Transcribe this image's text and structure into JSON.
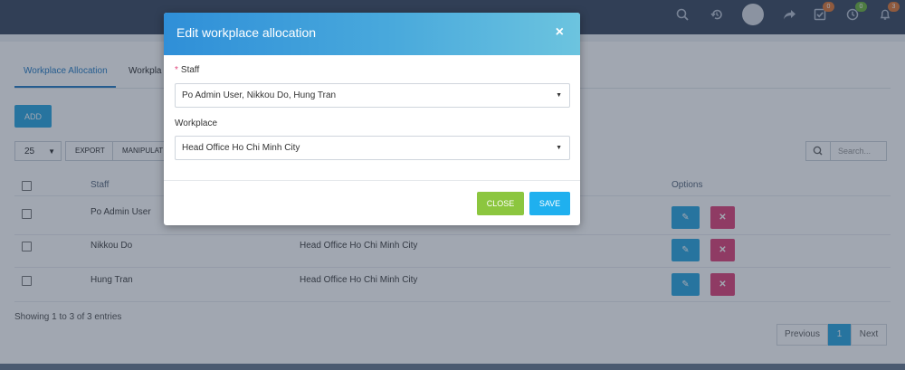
{
  "topbar": {
    "icons": [
      "search-icon",
      "history-icon",
      "share-icon",
      "tasks-icon",
      "clock-icon",
      "bell-icon"
    ],
    "badges": {
      "tasks": "0",
      "clock": "0",
      "bell": "3"
    },
    "badge_colors": {
      "tasks": "#e07b39",
      "clock": "#6fb43f",
      "bell": "#e07b39"
    }
  },
  "tabs": {
    "workplace_allocation": "Workplace Allocation",
    "second_tab": "Workpla"
  },
  "toolbar": {
    "add_label": "ADD",
    "page_size": "25",
    "export_label": "EXPORT",
    "manipulate_label": "MANIPULAT",
    "search_placeholder": "Search..."
  },
  "table": {
    "headers": {
      "staff": "Staff",
      "options": "Options"
    },
    "rows": [
      {
        "staff": "Po Admin User",
        "workplace": ""
      },
      {
        "staff": "Nikkou Do",
        "workplace": "Head Office Ho Chi Minh City"
      },
      {
        "staff": "Hung Tran",
        "workplace": "Head Office Ho Chi Minh City"
      }
    ]
  },
  "footer": {
    "showing": "Showing 1 to 3 of 3 entries",
    "previous": "Previous",
    "page": "1",
    "next": "Next"
  },
  "modal": {
    "title": "Edit workplace allocation",
    "close_glyph": "×",
    "staff_label": "Staff",
    "required_mark": "*",
    "staff_value": "Po Admin User, Nikkou Do, Hung Tran",
    "workplace_label": "Workplace",
    "workplace_value": "Head Office Ho Chi Minh City",
    "close_button": "CLOSE",
    "save_button": "SAVE"
  },
  "colors": {
    "primary": "#2ea7e0",
    "danger": "#e0457b",
    "success": "#8cc63f",
    "navbar": "#3f4d63"
  }
}
